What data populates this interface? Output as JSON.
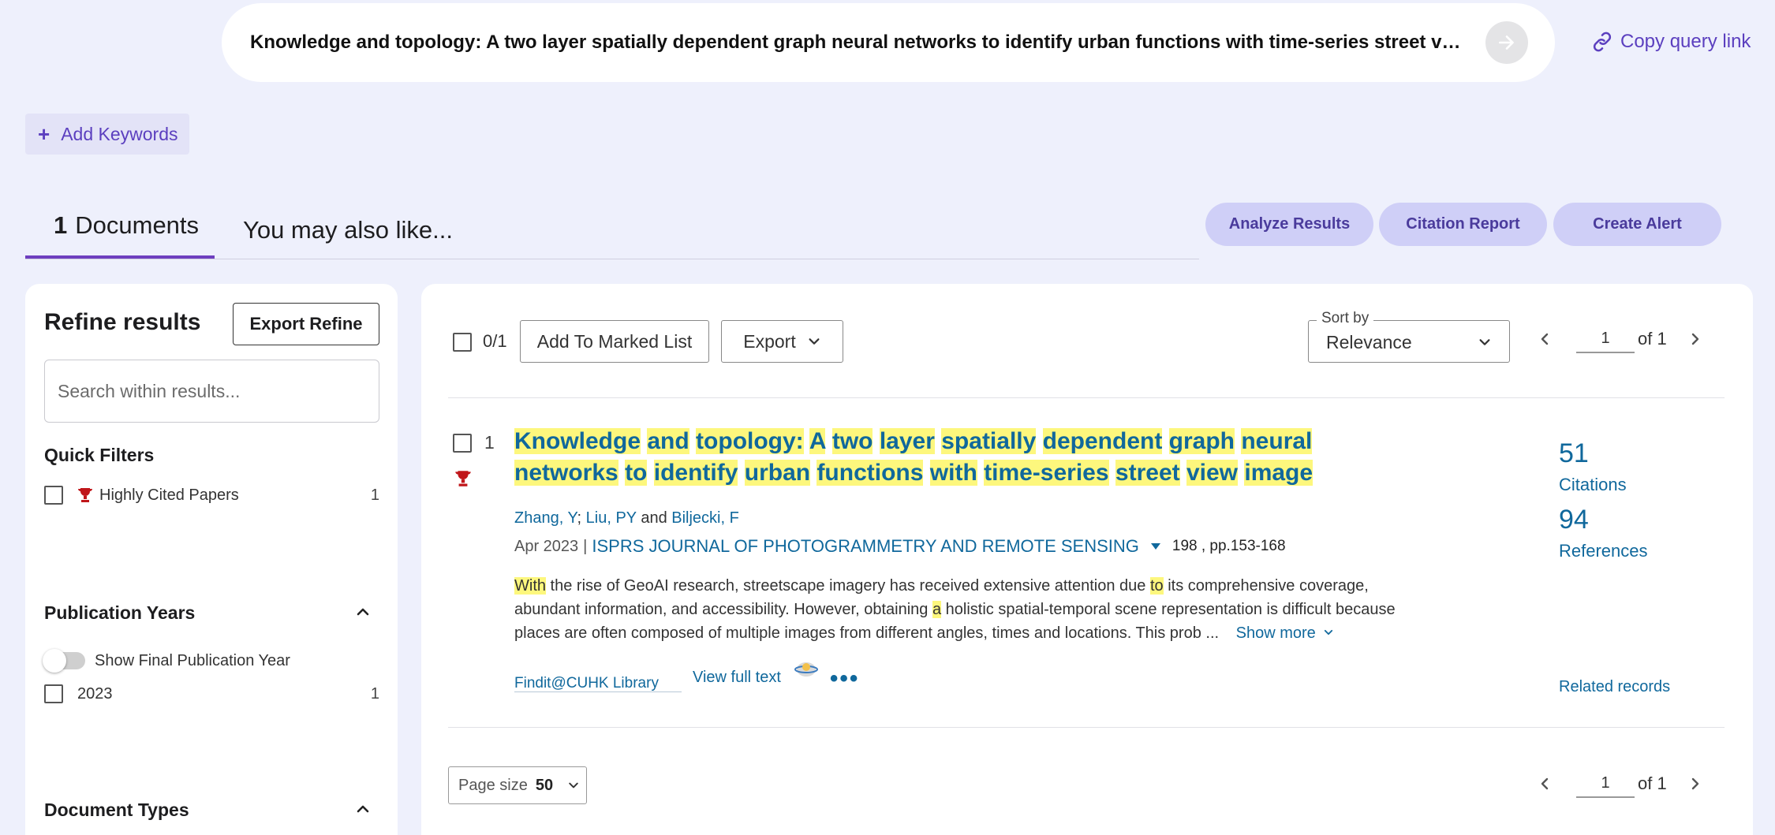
{
  "search": {
    "query": "Knowledge and topology: A two layer spatially dependent graph neural networks to identify urban functions with time-series street view image (Title)",
    "copy_link": "Copy query link"
  },
  "keywords": {
    "add_label": "Add Keywords"
  },
  "tabs": {
    "docs_count": "1",
    "docs_label": "Documents",
    "also_like": "You may also like..."
  },
  "actions": {
    "analyze": "Analyze Results",
    "citation_report": "Citation Report",
    "create_alert": "Create Alert"
  },
  "refine": {
    "title": "Refine results",
    "export_label": "Export Refine",
    "search_placeholder": "Search within results...",
    "quick_filters": {
      "heading": "Quick Filters",
      "items": [
        {
          "label": "Highly Cited Papers",
          "count": "1"
        }
      ]
    },
    "pub_years": {
      "heading": "Publication Years",
      "toggle_label": "Show Final Publication Year",
      "items": [
        {
          "label": "2023",
          "count": "1"
        }
      ]
    },
    "doc_types": {
      "heading": "Document Types"
    }
  },
  "toolbar": {
    "selected": "0/1",
    "add_marked": "Add To Marked List",
    "export": "Export",
    "sort_label": "Sort by",
    "sort_value": "Relevance",
    "page": "1",
    "of_total": "of 1"
  },
  "record": {
    "index": "1",
    "title_words": [
      "Knowledge",
      "and",
      "topology:",
      "A",
      "two",
      "layer",
      "spatially",
      "dependent",
      "graph",
      "neural",
      "networks",
      "to",
      "identify",
      "urban",
      "functions",
      "with",
      "time-series",
      "street",
      "view",
      "image"
    ],
    "authors": [
      {
        "name": "Zhang, Y"
      },
      {
        "name": "Liu, PY"
      },
      {
        "name": "Biljecki, F"
      }
    ],
    "author_sep": ";",
    "author_and": "and",
    "date": "Apr 2023",
    "journal": "ISPRS JOURNAL OF PHOTOGRAMMETRY AND REMOTE SENSING",
    "volume": "198 , pp.153-168",
    "abstract": {
      "line1_hl1": "With",
      "line1_mid": " the rise of GeoAI research, streetscape imagery has received extensive attention due ",
      "line1_hl2": "to",
      "line1_end": " its comprehensive coverage,",
      "line2_start": "abundant information, and accessibility. However, obtaining ",
      "line2_hl": "a",
      "line2_end": " holistic spatial-temporal scene representation is difficult because",
      "line3": "places are often composed of multiple images from different angles, times and locations. This prob  ...",
      "show_more": "Show more"
    },
    "findit_alt": "Findit@CUHK Library",
    "full_text": "View full text",
    "citations": "51",
    "citations_label": "Citations",
    "references": "94",
    "references_label": "References",
    "related": "Related records"
  },
  "footer": {
    "page_size_label": "Page size",
    "page_size_value": "50",
    "page": "1",
    "of_total": "of 1"
  },
  "colors": {
    "background": "#eef0fc",
    "accent": "#5b3fbf",
    "link": "#10689c",
    "highlight": "#fdf77d",
    "trophy": "#c0161a"
  }
}
